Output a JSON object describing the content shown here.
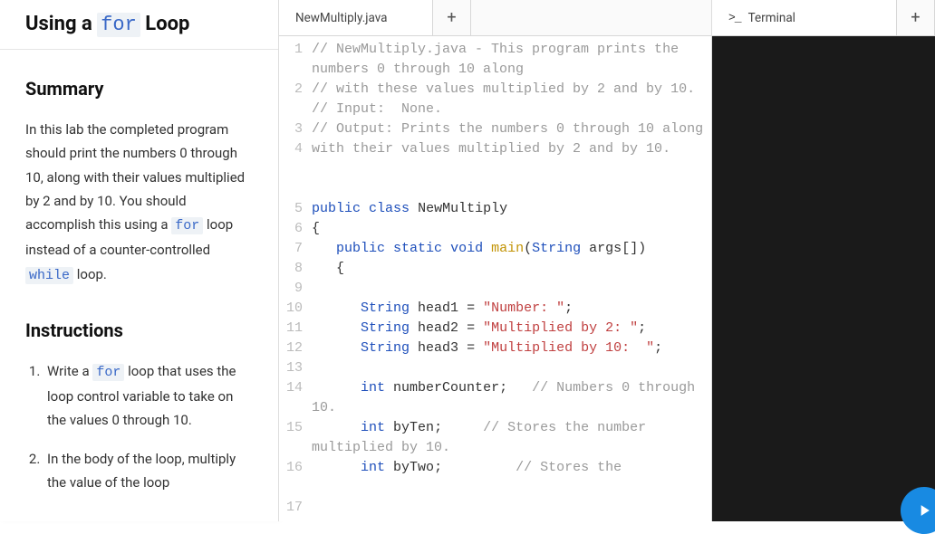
{
  "title": {
    "prefix": "Using a ",
    "code": "for",
    "suffix": " Loop"
  },
  "summary": {
    "heading": "Summary",
    "text_parts": [
      "In this lab the completed program should print the numbers 0 through 10, along with their values multiplied by 2 and by 10. You should accomplish this using a ",
      "for",
      " loop instead of a counter-controlled ",
      "while",
      " loop."
    ]
  },
  "instructions": {
    "heading": "Instructions",
    "items": [
      {
        "parts": [
          "Write a ",
          "for",
          " loop that uses the loop control variable to take on the values 0 through 10."
        ]
      },
      {
        "parts": [
          "In the body of the loop, multiply the value of the loop"
        ]
      }
    ]
  },
  "editor": {
    "tab_label": "NewMultiply.java",
    "add_icon": "+",
    "code_lines": [
      {
        "n": 1,
        "type": "comment",
        "text": "// NewMultiply.java - This program prints the numbers 0 through 10 along",
        "wrap_rows": 2
      },
      {
        "n": 2,
        "type": "comment",
        "text": "// with these values multiplied by 2 and by 10.",
        "wrap_rows": 2
      },
      {
        "n": 3,
        "type": "comment",
        "text": "// Input:  None.",
        "wrap_rows": 1
      },
      {
        "n": 4,
        "type": "comment",
        "text": "// Output: Prints the numbers 0 through 10 along with their values multiplied by 2 and by 10.",
        "wrap_rows": 3
      },
      {
        "n": 5,
        "type": "blank",
        "text": "",
        "wrap_rows": 1
      },
      {
        "n": 6,
        "type": "blank",
        "text": "",
        "wrap_rows": 1
      },
      {
        "n": 7,
        "type": "code",
        "tokens": [
          [
            "keyword",
            "public"
          ],
          [
            "space",
            " "
          ],
          [
            "keyword",
            "class"
          ],
          [
            "space",
            " "
          ],
          [
            "ident",
            "NewMultiply"
          ]
        ],
        "wrap_rows": 1
      },
      {
        "n": 8,
        "type": "code",
        "tokens": [
          [
            "punct",
            "{"
          ]
        ],
        "wrap_rows": 1
      },
      {
        "n": 9,
        "type": "code",
        "tokens": [
          [
            "space",
            "   "
          ],
          [
            "keyword",
            "public"
          ],
          [
            "space",
            " "
          ],
          [
            "keyword",
            "static"
          ],
          [
            "space",
            " "
          ],
          [
            "keyword",
            "void"
          ],
          [
            "space",
            " "
          ],
          [
            "func",
            "main"
          ],
          [
            "punct",
            "("
          ],
          [
            "type",
            "String"
          ],
          [
            "space",
            " "
          ],
          [
            "ident",
            "args"
          ],
          [
            "punct",
            "[])"
          ]
        ],
        "wrap_rows": 1
      },
      {
        "n": 10,
        "type": "code",
        "tokens": [
          [
            "space",
            "   "
          ],
          [
            "punct",
            "{"
          ]
        ],
        "wrap_rows": 1
      },
      {
        "n": 11,
        "type": "blank",
        "text": "",
        "wrap_rows": 1
      },
      {
        "n": 12,
        "type": "code",
        "tokens": [
          [
            "space",
            "      "
          ],
          [
            "type",
            "String"
          ],
          [
            "space",
            " "
          ],
          [
            "ident",
            "head1"
          ],
          [
            "space",
            " "
          ],
          [
            "punct",
            "="
          ],
          [
            "space",
            " "
          ],
          [
            "string",
            "\"Number: \""
          ],
          [
            "punct",
            ";"
          ]
        ],
        "wrap_rows": 1
      },
      {
        "n": 13,
        "type": "code",
        "tokens": [
          [
            "space",
            "      "
          ],
          [
            "type",
            "String"
          ],
          [
            "space",
            " "
          ],
          [
            "ident",
            "head2"
          ],
          [
            "space",
            " "
          ],
          [
            "punct",
            "="
          ],
          [
            "space",
            " "
          ],
          [
            "string",
            "\"Multiplied by 2: \""
          ],
          [
            "punct",
            ";"
          ]
        ],
        "wrap_rows": 1
      },
      {
        "n": 14,
        "type": "code",
        "tokens": [
          [
            "space",
            "      "
          ],
          [
            "type",
            "String"
          ],
          [
            "space",
            " "
          ],
          [
            "ident",
            "head3"
          ],
          [
            "space",
            " "
          ],
          [
            "punct",
            "="
          ],
          [
            "space",
            " "
          ],
          [
            "string",
            "\"Multiplied by 10:  \""
          ],
          [
            "punct",
            ";"
          ]
        ],
        "wrap_rows": 1
      },
      {
        "n": 15,
        "type": "code",
        "tokens": [
          [
            "space",
            "      "
          ],
          [
            "keyword",
            "int"
          ],
          [
            "space",
            " "
          ],
          [
            "ident",
            "numberCounter"
          ],
          [
            "punct",
            ";"
          ],
          [
            "space",
            "   "
          ],
          [
            "comment",
            "// Numbers 0 through 10."
          ]
        ],
        "wrap_rows": 2
      },
      {
        "n": 16,
        "type": "code",
        "tokens": [
          [
            "space",
            "      "
          ],
          [
            "keyword",
            "int"
          ],
          [
            "space",
            " "
          ],
          [
            "ident",
            "byTen"
          ],
          [
            "punct",
            ";"
          ],
          [
            "space",
            "     "
          ],
          [
            "comment",
            "// Stores the number multiplied by 10."
          ]
        ],
        "wrap_rows": 2
      },
      {
        "n": 17,
        "type": "code",
        "tokens": [
          [
            "space",
            "      "
          ],
          [
            "keyword",
            "int"
          ],
          [
            "space",
            " "
          ],
          [
            "ident",
            "byTwo"
          ],
          [
            "punct",
            ";"
          ],
          [
            "space",
            "         "
          ],
          [
            "comment",
            "// Stores the"
          ]
        ],
        "wrap_rows": 1
      }
    ]
  },
  "terminal": {
    "tab_label": "Terminal",
    "prompt_icon": ">_",
    "add_icon": "+"
  }
}
